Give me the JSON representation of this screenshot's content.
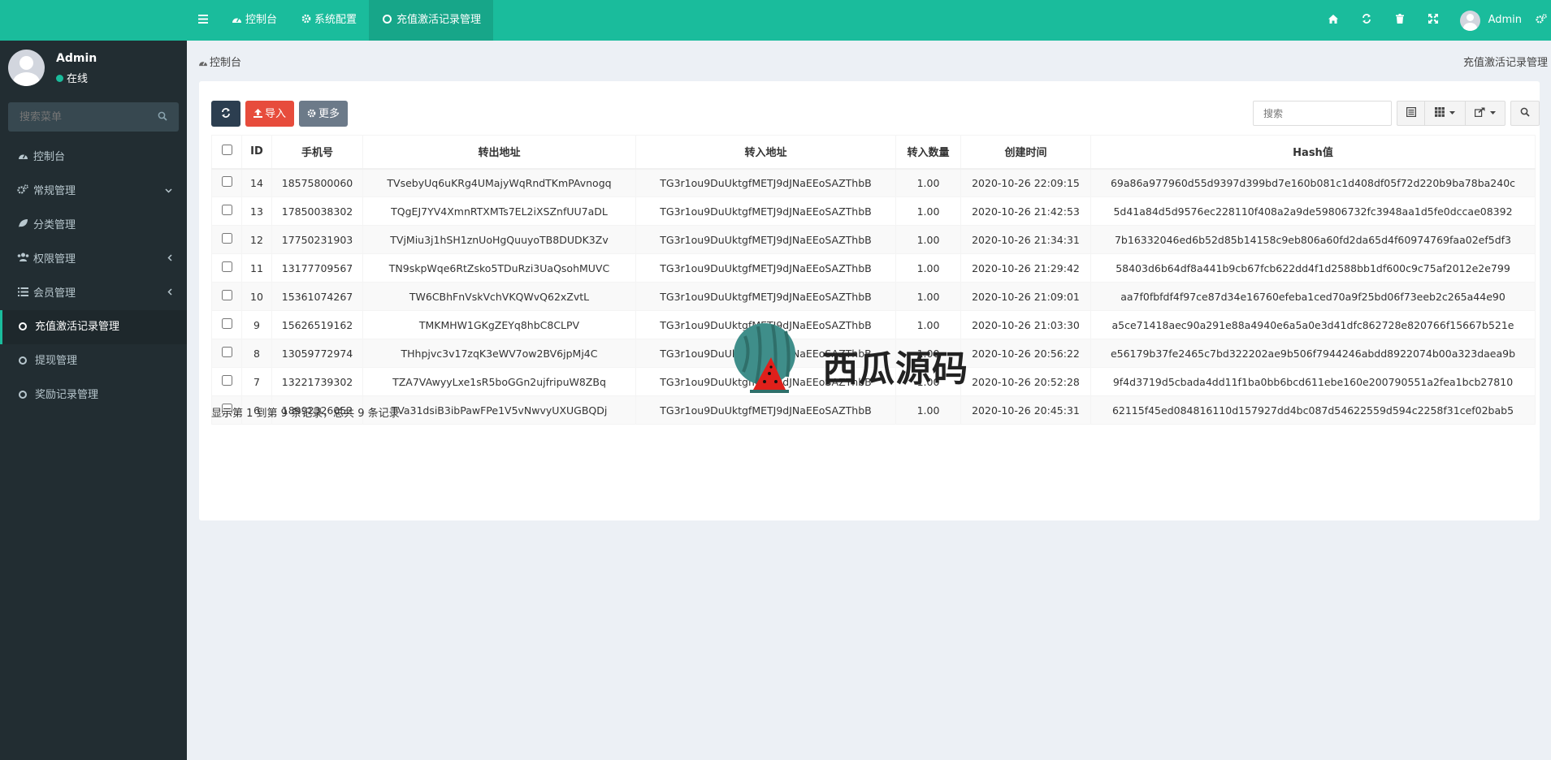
{
  "sidebar": {
    "user": {
      "name": "Admin",
      "status": "在线"
    },
    "search_placeholder": "搜索菜单",
    "items": [
      {
        "label": "控制台",
        "icon": "dashboard-icon"
      },
      {
        "label": "常规管理",
        "icon": "cogs-icon"
      },
      {
        "label": "分类管理",
        "icon": "leaf-icon"
      },
      {
        "label": "权限管理",
        "icon": "group-icon"
      },
      {
        "label": "会员管理",
        "icon": "list-icon"
      },
      {
        "label": "充值激活记录管理",
        "icon": "circle-icon"
      },
      {
        "label": "提现管理",
        "icon": "circle-icon"
      },
      {
        "label": "奖励记录管理",
        "icon": "circle-icon"
      }
    ]
  },
  "topnav": {
    "tabs": [
      {
        "label": "控制台"
      },
      {
        "label": "系统配置"
      },
      {
        "label": "充值激活记录管理"
      }
    ],
    "user_name": "Admin"
  },
  "breadcrumb": {
    "left": "控制台",
    "right": "充值激活记录管理"
  },
  "toolbar": {
    "import_label": "导入",
    "more_label": "更多",
    "search_placeholder": "搜索"
  },
  "table": {
    "headers": [
      "ID",
      "手机号",
      "转出地址",
      "转入地址",
      "转入数量",
      "创建时间",
      "Hash值"
    ],
    "rows": [
      [
        "14",
        "18575800060",
        "TVsebyUq6uKRg4UMajyWqRndTKmPAvnogq",
        "TG3r1ou9DuUktgfMETJ9dJNaEEoSAZThbB",
        "1.00",
        "2020-10-26 22:09:15",
        "69a86a977960d55d9397d399bd7e160b081c1d408df05f72d220b9ba78ba240c"
      ],
      [
        "13",
        "17850038302",
        "TQgEJ7YV4XmnRTXMTs7EL2iXSZnfUU7aDL",
        "TG3r1ou9DuUktgfMETJ9dJNaEEoSAZThbB",
        "1.00",
        "2020-10-26 21:42:53",
        "5d41a84d5d9576ec228110f408a2a9de59806732fc3948aa1d5fe0dccae08392"
      ],
      [
        "12",
        "17750231903",
        "TVjMiu3j1hSH1znUoHgQuuyoTB8DUDK3Zv",
        "TG3r1ou9DuUktgfMETJ9dJNaEEoSAZThbB",
        "1.00",
        "2020-10-26 21:34:31",
        "7b16332046ed6b52d85b14158c9eb806a60fd2da65d4f60974769faa02ef5df3"
      ],
      [
        "11",
        "13177709567",
        "TN9skpWqe6RtZsko5TDuRzi3UaQsohMUVC",
        "TG3r1ou9DuUktgfMETJ9dJNaEEoSAZThbB",
        "1.00",
        "2020-10-26 21:29:42",
        "58403d6b64df8a441b9cb67fcb622dd4f1d2588bb1df600c9c75af2012e2e799"
      ],
      [
        "10",
        "15361074267",
        "TW6CBhFnVskVchVKQWvQ62xZvtL",
        "TG3r1ou9DuUktgfMETJ9dJNaEEoSAZThbB",
        "1.00",
        "2020-10-26 21:09:01",
        "aa7f0fbfdf4f97ce87d34e16760efeba1ced70a9f25bd06f73eeb2c265a44e90"
      ],
      [
        "9",
        "15626519162",
        "TMKMHW1GKgZEYq8hbC8CLPV",
        "TG3r1ou9DuUktgfMETJ9dJNaEEoSAZThbB",
        "1.00",
        "2020-10-26 21:03:30",
        "a5ce71418aec90a291e88a4940e6a5a0e3d41dfc862728e820766f15667b521e"
      ],
      [
        "8",
        "13059772974",
        "THhpjvc3v17zqK3eWV7ow2BV6jpMj4C",
        "TG3r1ou9DuUktgfMETJ9dJNaEEoSAZThbB",
        "1.00",
        "2020-10-26 20:56:22",
        "e56179b37fe2465c7bd322202ae9b506f7944246abdd8922074b00a323daea9b"
      ],
      [
        "7",
        "13221739302",
        "TZA7VAwyyLxe1sR5boGGn2ujfripuW8ZBq",
        "TG3r1ou9DuUktgfMETJ9dJNaEEoSAZThbB",
        "1.00",
        "2020-10-26 20:52:28",
        "9f4d3719d5cbada4dd11f1ba0bb6bcd611ebe160e200790551a2fea1bcb27810"
      ],
      [
        "6",
        "18992326052",
        "TVa31dsiB3ibPawFPe1V5vNwvyUXUGBQDj",
        "TG3r1ou9DuUktgfMETJ9dJNaEEoSAZThbB",
        "1.00",
        "2020-10-26 20:45:31",
        "62115f45ed084816110d157927dd4bc087d54622559d594c2258f31cef02bab5"
      ]
    ]
  },
  "pagination_info": "显示第 1 到第 9 条记录，总共 9 条记录",
  "watermark_text": "西瓜源码",
  "colors": {
    "accent": "#1abc9c",
    "sidebar": "#222d32",
    "danger": "#e74c3c"
  }
}
